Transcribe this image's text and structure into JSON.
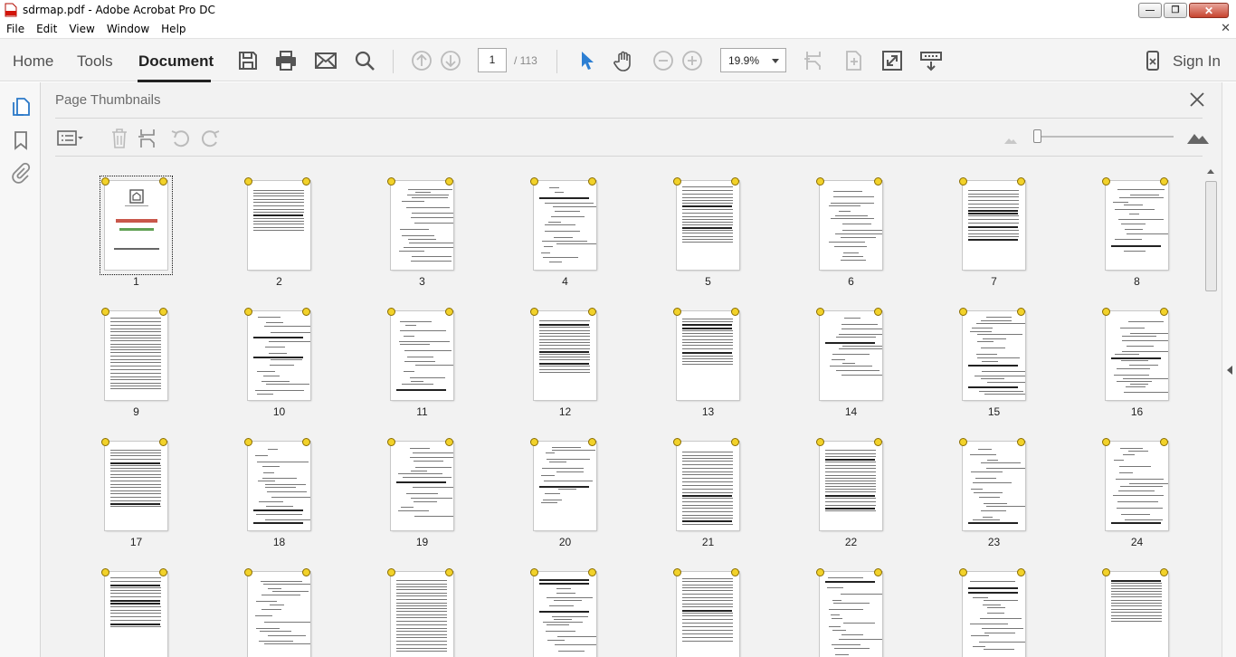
{
  "window": {
    "title": "sdrmap.pdf - Adobe Acrobat Pro DC"
  },
  "menu": [
    "File",
    "Edit",
    "View",
    "Window",
    "Help"
  ],
  "toolbar": {
    "tabs": [
      "Home",
      "Tools",
      "Document"
    ],
    "active_tab": "Document",
    "page_current": "1",
    "page_total": "/ 113",
    "zoom": "19.9%",
    "sign_in": "Sign In",
    "icons": [
      "save-icon",
      "print-icon",
      "email-icon",
      "search-icon",
      "page-up-icon",
      "page-down-icon",
      "select-arrow-icon",
      "hand-icon",
      "zoom-out-icon",
      "zoom-in-icon",
      "insert-page-icon",
      "extract-page-icon",
      "full-screen-icon",
      "read-mode-icon",
      "mobile-link-icon"
    ]
  },
  "left_rail": {
    "icons": [
      "page-thumbnails-icon",
      "bookmark-icon",
      "attachment-icon"
    ]
  },
  "panel": {
    "title": "Page Thumbnails",
    "tools": [
      "options-menu-icon",
      "delete-icon",
      "insert-icon",
      "rotate-left-icon",
      "rotate-right-icon"
    ],
    "zoom_small_icon": "mountain-small-icon",
    "zoom_large_icon": "mountain-large-icon",
    "thumbnail_size_level": 0.0
  },
  "thumbnails": {
    "selected": 1,
    "pages": [
      {
        "num": "1"
      },
      {
        "num": "2"
      },
      {
        "num": "3"
      },
      {
        "num": "4"
      },
      {
        "num": "5"
      },
      {
        "num": "6"
      },
      {
        "num": "7"
      },
      {
        "num": "8"
      },
      {
        "num": "9"
      },
      {
        "num": "10"
      },
      {
        "num": "11"
      },
      {
        "num": "12"
      },
      {
        "num": "13"
      },
      {
        "num": "14"
      },
      {
        "num": "15"
      },
      {
        "num": "16"
      },
      {
        "num": "17"
      },
      {
        "num": "18"
      },
      {
        "num": "19"
      },
      {
        "num": "20"
      },
      {
        "num": "21"
      },
      {
        "num": "22"
      },
      {
        "num": "23"
      },
      {
        "num": "24"
      },
      {
        "num": ""
      },
      {
        "num": ""
      },
      {
        "num": ""
      },
      {
        "num": ""
      },
      {
        "num": ""
      },
      {
        "num": ""
      },
      {
        "num": ""
      },
      {
        "num": ""
      }
    ]
  },
  "page1": {
    "heading": "SDRmap",
    "sub": "Quick reference"
  },
  "colors": {
    "badge": "#f2d22a",
    "page1_green": "#3a8a2a",
    "page1_red": "#c0392b"
  }
}
